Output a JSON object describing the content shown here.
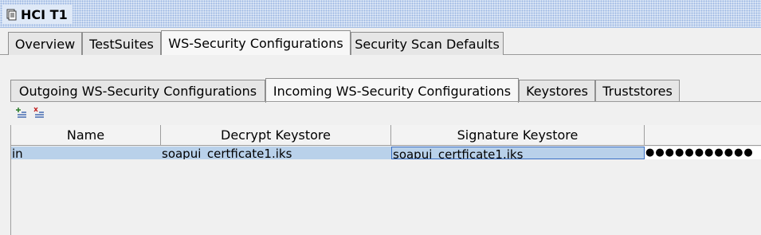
{
  "window": {
    "title": "HCI T1"
  },
  "main_tabs": [
    {
      "label": "Overview"
    },
    {
      "label": "TestSuites"
    },
    {
      "label": "WS-Security Configurations"
    },
    {
      "label": "Security Scan Defaults"
    }
  ],
  "active_main_tab": "WS-Security Configurations",
  "sub_tabs": [
    {
      "label": "Outgoing WS-Security Configurations"
    },
    {
      "label": "Incoming WS-Security Configurations"
    },
    {
      "label": "Keystores"
    },
    {
      "label": "Truststores"
    }
  ],
  "active_sub_tab": "Incoming WS-Security Configurations",
  "toolbar": {
    "add_icon": "add-row-icon",
    "remove_icon": "remove-row-icon"
  },
  "table": {
    "columns": [
      "Name",
      "Decrypt Keystore",
      "Signature Keystore",
      ""
    ],
    "rows": [
      {
        "name": "in",
        "decrypt_keystore": "soapui_certficate1.iks",
        "signature_keystore": "soapui_certficate1.iks",
        "password": "●●●●●●●●●●●"
      }
    ]
  },
  "colors": {
    "selection": "#b9d1ea",
    "title_bar": "#dfe9f7"
  }
}
